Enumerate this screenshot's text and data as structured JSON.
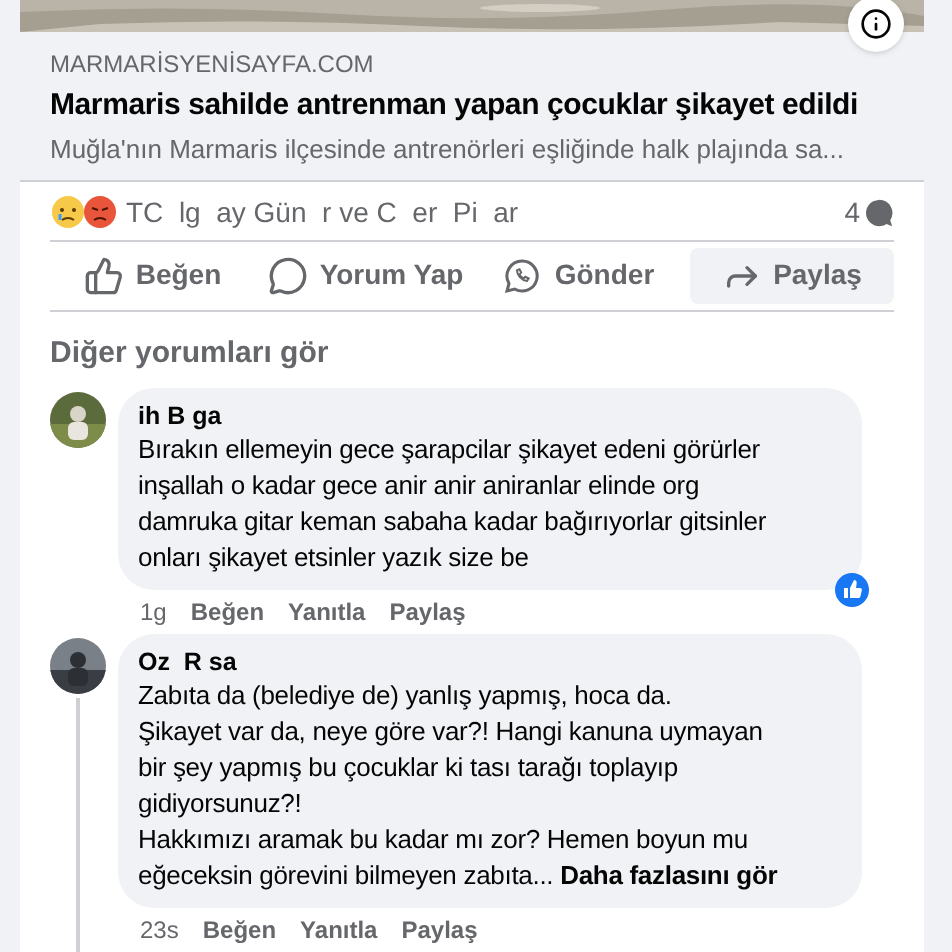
{
  "link_preview": {
    "domain": "MARMARİSYENİSAYFA.COM",
    "title": "Marmaris sahilde antrenman yapan çocuklar şikayet edildi",
    "description": "Muğla'nın Marmaris ilçesinde antrenörleri eşliğinde halk plajında sa..."
  },
  "reactions": {
    "names": "TC  lg  ay Gün  r ve C  er  Pi  ar",
    "comment_count": "4"
  },
  "actions": [
    {
      "kind": "like",
      "label": "Beğen",
      "selected": false
    },
    {
      "kind": "comment",
      "label": "Yorum Yap",
      "selected": false
    },
    {
      "kind": "send",
      "label": "Gönder",
      "selected": false
    },
    {
      "kind": "share",
      "label": "Paylaş",
      "selected": true
    }
  ],
  "more_comments": "Diğer yorumları gör",
  "comments": [
    {
      "author": "ih B ga",
      "lines": [
        "Bırakın ellemeyin gece şarapcilar şikayet edeni görürler",
        "inşallah o kadar gece anir anir aniranlar elinde org",
        "damruka gitar keman sabaha kadar bağırıyorlar gitsinler",
        "onları şikayet etsinler yazık size be"
      ],
      "time": "1g",
      "like": "Beğen",
      "reply": "Yanıtla",
      "share": "Paylaş",
      "liked": true,
      "thread": false
    },
    {
      "author": "Oz  R sa",
      "lines": [
        "Zabıta da (belediye de) yanlış yapmış, hoca da.",
        "Şikayet var da, neye göre var?! Hangi kanuna uymayan",
        "bir şey yapmış bu çocuklar ki tası tarağı toplayıp",
        "gidiyorsunuz?!",
        "Hakkımızı aramak bu kadar mı zor? Hemen boyun mu",
        "eğeceksin görevini bilmeyen zabıta..."
      ],
      "see_more": "Daha fazlasını gör",
      "time": "23s",
      "like": "Beğen",
      "reply": "Yanıtla",
      "share": "Paylaş",
      "liked": false,
      "thread": true
    }
  ]
}
